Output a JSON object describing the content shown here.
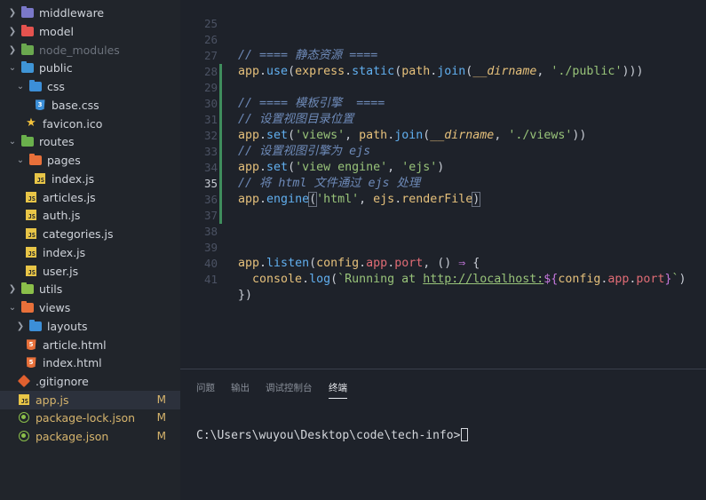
{
  "explorer": {
    "items": [
      {
        "label": "middleware",
        "badge": ""
      },
      {
        "label": "model",
        "badge": ""
      },
      {
        "label": "node_modules",
        "badge": ""
      },
      {
        "label": "public",
        "badge": ""
      },
      {
        "label": "css",
        "badge": ""
      },
      {
        "label": "base.css",
        "badge": ""
      },
      {
        "label": "favicon.ico",
        "badge": ""
      },
      {
        "label": "routes",
        "badge": ""
      },
      {
        "label": "pages",
        "badge": ""
      },
      {
        "label": "index.js",
        "badge": ""
      },
      {
        "label": "articles.js",
        "badge": ""
      },
      {
        "label": "auth.js",
        "badge": ""
      },
      {
        "label": "categories.js",
        "badge": ""
      },
      {
        "label": "index.js",
        "badge": ""
      },
      {
        "label": "user.js",
        "badge": ""
      },
      {
        "label": "utils",
        "badge": ""
      },
      {
        "label": "views",
        "badge": ""
      },
      {
        "label": "layouts",
        "badge": ""
      },
      {
        "label": "article.html",
        "badge": ""
      },
      {
        "label": "index.html",
        "badge": ""
      },
      {
        "label": ".gitignore",
        "badge": ""
      },
      {
        "label": "app.js",
        "badge": "M"
      },
      {
        "label": "package-lock.json",
        "badge": "M"
      },
      {
        "label": "package.json",
        "badge": "M"
      }
    ]
  },
  "editor": {
    "line_numbers": [
      "25",
      "26",
      "27",
      "28",
      "29",
      "30",
      "31",
      "32",
      "33",
      "34",
      "35",
      "36",
      "37",
      "38",
      "39",
      "40",
      "41"
    ],
    "active_line": "35",
    "tokens": {
      "l26_comment": "// ==== 静态资源 ====",
      "l27_app": "app",
      "l27_use": "use",
      "l27_express": "express",
      "l27_static": "static",
      "l27_path": "path",
      "l27_join": "join",
      "l27_dirname": "__dirname",
      "l27_str": "'./public'",
      "l29_comment": "// ==== 模板引擎  ====",
      "l30_comment": "// 设置视图目录位置",
      "l31_app": "app",
      "l31_set": "set",
      "l31_str1": "'views'",
      "l31_path": "path",
      "l31_join": "join",
      "l31_dirname": "__dirname",
      "l31_str2": "'./views'",
      "l32_comment": "// 设置视图引擎为 ejs",
      "l33_app": "app",
      "l33_set": "set",
      "l33_str1": "'view engine'",
      "l33_str2": "'ejs'",
      "l34_comment": "// 将 html 文件通过 ejs 处理",
      "l35_app": "app",
      "l35_engine": "engine",
      "l35_str": "'html'",
      "l35_ejs": "ejs",
      "l35_render": "renderFile",
      "l39_app": "app",
      "l39_listen": "listen",
      "l39_config": "config",
      "l39_app2": "app",
      "l39_port": "port",
      "l39_arrow": "⇒",
      "l40_console": "console",
      "l40_log": "log",
      "l40_tmpl_start": "`Running at ",
      "l40_url": "http://localhost:",
      "l40_interp_open": "${",
      "l40_config": "config",
      "l40_app": "app",
      "l40_port": "port",
      "l40_interp_close": "}",
      "l40_tmpl_end": "`",
      "l41_close": "})"
    }
  },
  "panel": {
    "tabs": [
      "问题",
      "输出",
      "调试控制台",
      "终端"
    ],
    "active_tab": "终端",
    "terminal_prompt": "C:\\Users\\wuyou\\Desktop\\code\\tech-info>"
  },
  "colors": {
    "sidebar_bg": "#21252b",
    "editor_bg": "#1e222a",
    "comment": "#6e8ab8",
    "string": "#98c379",
    "function": "#61afef",
    "object": "#e5c07b",
    "property": "#e06c75",
    "modified_badge": "#d7b56d",
    "git_modified_bar": "#3f8d5d"
  }
}
